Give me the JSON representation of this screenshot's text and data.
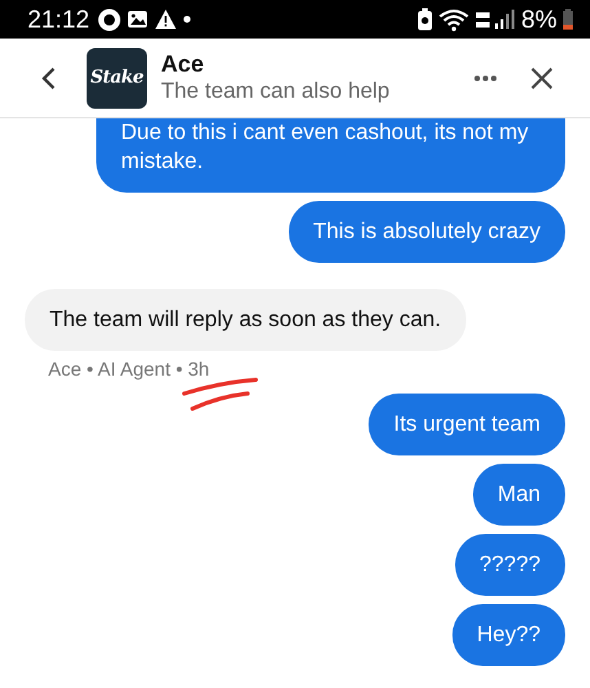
{
  "status_bar": {
    "time": "21:12",
    "battery": "8%"
  },
  "header": {
    "logo_text": "Stake",
    "title": "Ace",
    "subtitle": "The team can also help"
  },
  "messages": [
    {
      "kind": "outgoing",
      "text": "Due to this i cant even cashout, its not my mistake.",
      "cut_top": true
    },
    {
      "kind": "outgoing",
      "text": "This is absolutely crazy"
    },
    {
      "kind": "incoming",
      "text": "The team will reply as soon as they can.",
      "meta": "Ace • AI Agent • 3h",
      "underlined": true
    },
    {
      "kind": "outgoing",
      "text": "Its urgent team"
    },
    {
      "kind": "outgoing",
      "text": "Man"
    },
    {
      "kind": "outgoing",
      "text": "?????"
    },
    {
      "kind": "outgoing",
      "text": "Hey??"
    }
  ]
}
